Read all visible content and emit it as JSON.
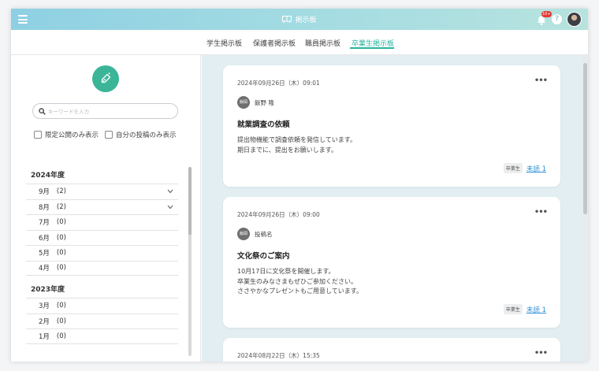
{
  "header": {
    "title": "掲示板",
    "notification_count": "10+",
    "help_label": "?"
  },
  "tabs": [
    {
      "label": "学生掲示板"
    },
    {
      "label": "保護者掲示板"
    },
    {
      "label": "職員掲示板"
    },
    {
      "label": "卒業生掲示板",
      "active": true
    }
  ],
  "sidebar": {
    "search_placeholder": "キーワードを入力",
    "filters": [
      "限定公開のみ表示",
      "自分の投稿のみ表示"
    ],
    "archive": [
      {
        "year": "2024年度",
        "months": [
          {
            "month": "9月",
            "count": "(2)",
            "expandable": true
          },
          {
            "month": "8月",
            "count": "(2)",
            "expandable": true
          },
          {
            "month": "7月",
            "count": "(0)"
          },
          {
            "month": "6月",
            "count": "(0)"
          },
          {
            "month": "5月",
            "count": "(0)"
          },
          {
            "month": "4月",
            "count": "(0)"
          }
        ]
      },
      {
        "year": "2023年度",
        "months": [
          {
            "month": "3月",
            "count": "(0)"
          },
          {
            "month": "2月",
            "count": "(0)"
          },
          {
            "month": "1月",
            "count": "(0)"
          }
        ]
      }
    ]
  },
  "posts": [
    {
      "date": "2024年09月26日（木）09:01",
      "role": "飯岡",
      "author": "飯野 隆",
      "title": "就業調査の依頼",
      "body": [
        "提出物機能で調査依頼を発信しています。",
        "期日までに、提出をお願いします。"
      ],
      "tag": "卒業生",
      "unread": "未読 1"
    },
    {
      "date": "2024年09月26日（木）09:00",
      "role": "飯岡",
      "author": "投稿名",
      "title": "文化祭のご案内",
      "body": [
        "10月17日に文化祭を開催します。",
        "卒業生のみなさまもぜひご参加ください。",
        "ささやかなプレゼントもご用意しています。"
      ],
      "tag": "卒業生",
      "unread": "未読 1"
    },
    {
      "date": "2024年08月22日（木）15:35"
    }
  ],
  "colors": {
    "accent": "#2ab3a0",
    "fab": "#3bb598",
    "link": "#2a8fd6",
    "badge": "#e53935"
  }
}
